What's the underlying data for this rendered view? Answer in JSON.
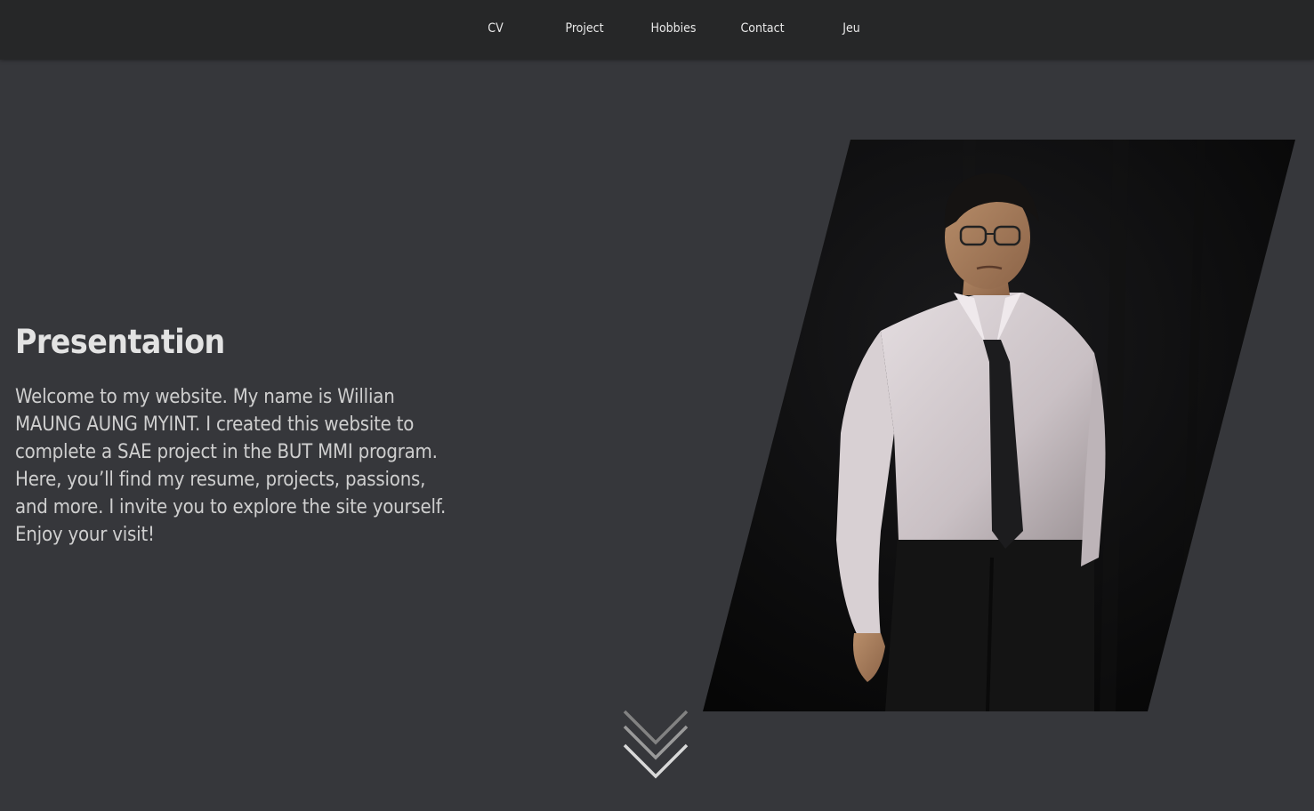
{
  "nav": {
    "items": [
      {
        "label": "CV"
      },
      {
        "label": "Project"
      },
      {
        "label": "Hobbies"
      },
      {
        "label": "Contact"
      },
      {
        "label": "Jeu"
      }
    ]
  },
  "presentation": {
    "title": "Presentation",
    "text": "Welcome to my website. My name is Willian MAUNG AUNG MYINT. I created this website to complete a SAE project in the BUT MMI program. Here, you’ll find my resume, projects, passions, and more. I invite you to explore the site yourself. Enjoy your visit!"
  },
  "icons": {
    "scroll": "double-chevron-down-icon"
  },
  "colors": {
    "page_background": "#36373b",
    "navbar_background": "#262728",
    "nav_text": "#e8e8e8",
    "title_text": "#e3e3e3",
    "body_text": "#cfcfcf"
  }
}
